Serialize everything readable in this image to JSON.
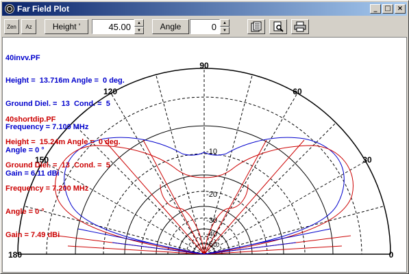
{
  "window": {
    "title": "Far Field Plot",
    "controls": {
      "minimize": "_",
      "maximize": "□",
      "close": "×"
    }
  },
  "toolbar": {
    "zen_label": "Zen",
    "az_label": "Az",
    "height_button": "Height '",
    "height_value": "45.00",
    "angle_button": "Angle",
    "angle_value": "0",
    "icons": [
      "properties-icon",
      "print-preview-icon",
      "printer-icon"
    ]
  },
  "plot": {
    "angle_labels": {
      "a90": "90",
      "a120": "120",
      "a60": "60",
      "a150": "150",
      "a30": "30",
      "a180": "180",
      "a0": "0"
    },
    "ring_labels": {
      "r10": "-10",
      "r20": "-20",
      "r30": "-30",
      "r40": "-40",
      "r50": "-50"
    },
    "colors": {
      "trace1": "#0000cc",
      "trace2": "#cc0000"
    }
  },
  "trace1": {
    "file": "40invv.PF",
    "height": "Height =  13.716m Angle =  0 deg.",
    "ground": "Ground Diel. =  13  Cond. =  5",
    "frequency": "Frequency = 7.100 MHz",
    "angle": "Angle = 0 °",
    "gain": "Gain = 6.11 dBi"
  },
  "trace2": {
    "file": "40shortdip.PF",
    "height": "Height =  15.24m Angle =  0 deg.",
    "ground": "Ground Diel. =  13  Cond. =  5",
    "frequency": "Frequency = 7.200 MHz",
    "angle": "Angle = 0 °",
    "gain": "Gain = 7.49 dBi"
  }
}
